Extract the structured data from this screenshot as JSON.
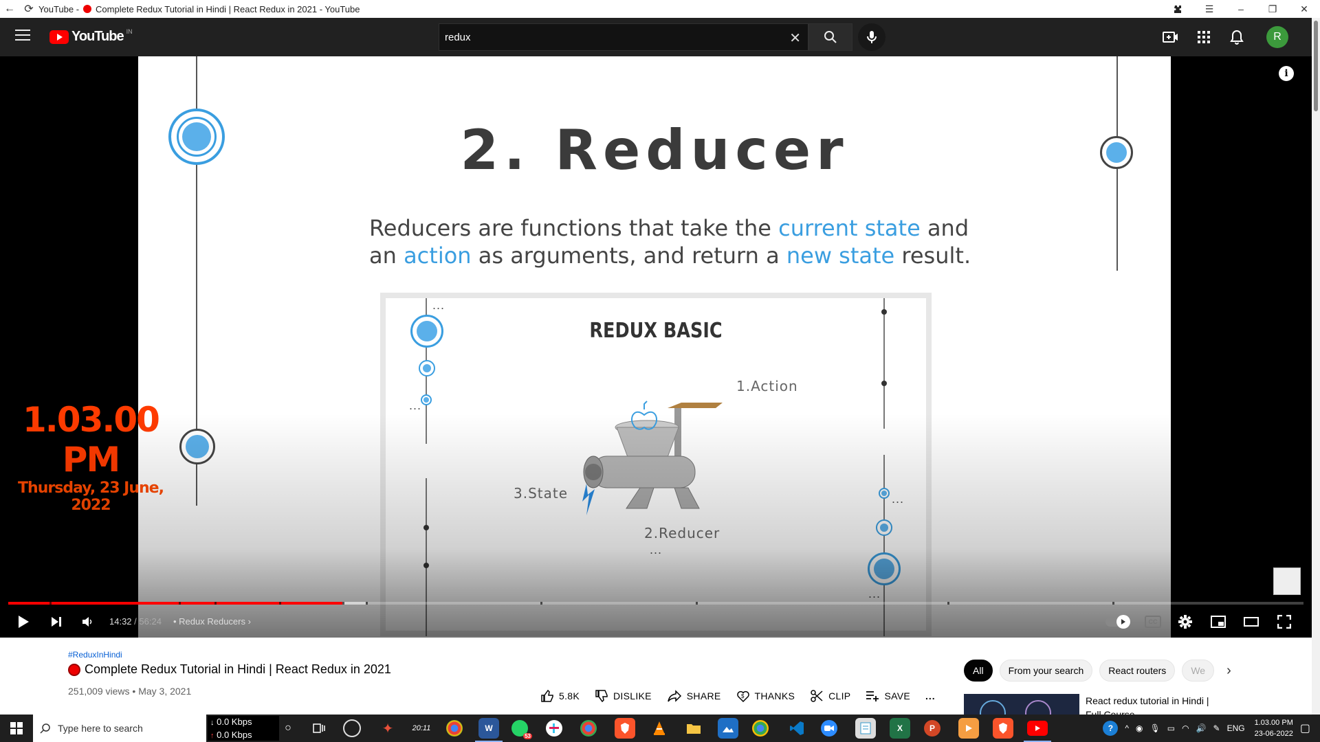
{
  "window": {
    "title_prefix": "YouTube -",
    "title": "Complete Redux Tutorial in Hindi | React Redux in 2021 - YouTube"
  },
  "header": {
    "logo_text": "YouTube",
    "region": "IN",
    "search_value": "redux",
    "avatar_letter": "R"
  },
  "slide": {
    "title": "2. Reducer",
    "body_part1": "Reducers are functions that take the ",
    "body_hl1": "current state",
    "body_part2": " and an ",
    "body_hl2": "action",
    "body_part3": " as arguments, and return a ",
    "body_hl3": "new state",
    "body_part4": " result.",
    "diagram_title": "REDUX BASIC",
    "label_action": "1.Action",
    "label_state": "3.State",
    "label_reducer": "2.Reducer",
    "ellipsis": "..."
  },
  "overlay": {
    "time": "1.03.00 PM",
    "date": "Thursday, 23 June, 2022"
  },
  "player": {
    "current_time": "14:32",
    "duration": "56:24",
    "separator": " / ",
    "chapter": "• Redux Reducers",
    "progress_fraction": 0.2578,
    "buffer_fraction": 0.276,
    "info_icon": "i",
    "cc_label": "CC"
  },
  "video": {
    "hashtag": "#ReduxInHindi",
    "title": "Complete Redux Tutorial in Hindi | React Redux in 2021",
    "views": "251,009 views",
    "date": "May 3, 2021",
    "likes": "5.8K",
    "dislike_label": "DISLIKE",
    "share_label": "SHARE",
    "thanks_label": "THANKS",
    "clip_label": "CLIP",
    "save_label": "SAVE",
    "more_label": "..."
  },
  "chips": [
    "All",
    "From your search",
    "React routers",
    "We"
  ],
  "recommendation": {
    "title": "React redux tutorial in Hindi | Full Course"
  },
  "taskbar": {
    "search_placeholder": "Type here to search",
    "net_down": "0.0 Kbps",
    "net_up": "0.0 Kbps",
    "lang": "ENG",
    "time": "1.03.00 PM",
    "date": "23-06-2022",
    "whatsapp_badge": "53",
    "clock_app_text": "20:11"
  },
  "colors": {
    "accent_red": "#ff0000",
    "overlay_orange": "#ff3b00",
    "slide_highlight": "#3a9ee0"
  }
}
